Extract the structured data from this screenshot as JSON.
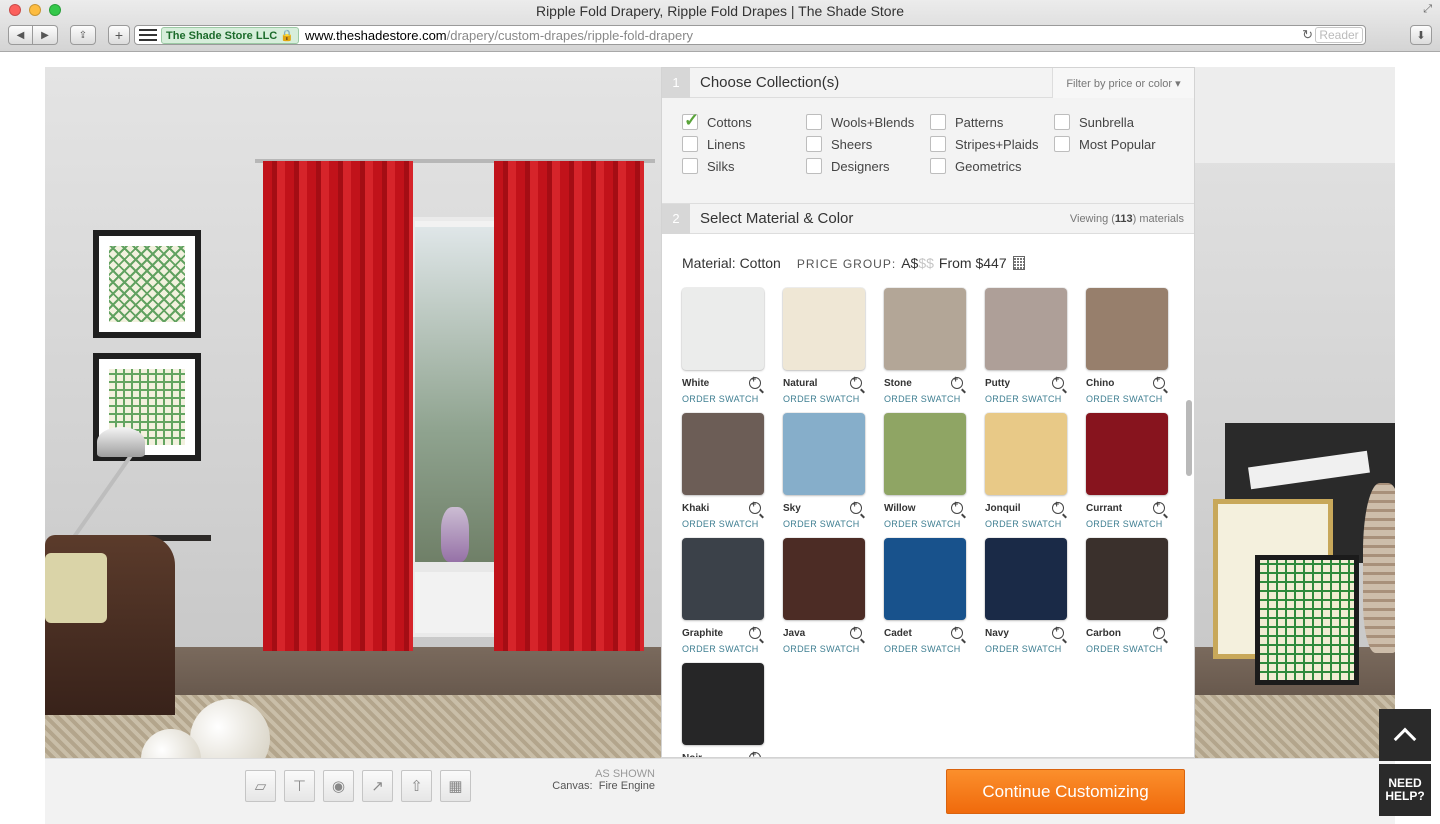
{
  "browser": {
    "window_title": "Ripple Fold Drapery, Ripple Fold Drapes | The Shade Store",
    "site_badge": "The Shade Store LLC",
    "url_host": "www.theshadestore.com",
    "url_path": "/drapery/custom-drapes/ripple-fold-drapery",
    "reader_label": "Reader"
  },
  "collections": {
    "step": "1",
    "title": "Choose Collection(s)",
    "filter_label": "Filter by price or color ▾",
    "items": [
      {
        "label": "Cottons",
        "checked": true
      },
      {
        "label": "Wools+Blends",
        "checked": false
      },
      {
        "label": "Patterns",
        "checked": false
      },
      {
        "label": "Sunbrella",
        "checked": false
      },
      {
        "label": "Linens",
        "checked": false
      },
      {
        "label": "Sheers",
        "checked": false
      },
      {
        "label": "Stripes+Plaids",
        "checked": false
      },
      {
        "label": "Most Popular",
        "checked": false
      },
      {
        "label": "Silks",
        "checked": false
      },
      {
        "label": "Designers",
        "checked": false
      },
      {
        "label": "Geometrics",
        "checked": false
      }
    ]
  },
  "materials": {
    "step": "2",
    "title": "Select Material & Color",
    "viewing_prefix": "Viewing (",
    "viewing_count": "113",
    "viewing_suffix": ") materials",
    "material_label": "Material: Cotton",
    "price_group_label": "PRICE GROUP:",
    "price_letter": "A",
    "price_dollars": "$",
    "price_dollars_dim": "$$",
    "price_from": "From $447",
    "order_swatch_label": "ORDER SWATCH",
    "swatches": [
      {
        "name": "White",
        "color": "#ebeceb"
      },
      {
        "name": "Natural",
        "color": "#efe7d5"
      },
      {
        "name": "Stone",
        "color": "#b3a697"
      },
      {
        "name": "Putty",
        "color": "#ae9f98"
      },
      {
        "name": "Chino",
        "color": "#977f6c"
      },
      {
        "name": "Khaki",
        "color": "#6c5d56"
      },
      {
        "name": "Sky",
        "color": "#86aeca"
      },
      {
        "name": "Willow",
        "color": "#8fa564"
      },
      {
        "name": "Jonquil",
        "color": "#e8c987"
      },
      {
        "name": "Currant",
        "color": "#87141e"
      },
      {
        "name": "Graphite",
        "color": "#3b4149"
      },
      {
        "name": "Java",
        "color": "#4c2c25"
      },
      {
        "name": "Cadet",
        "color": "#18528c"
      },
      {
        "name": "Navy",
        "color": "#1a2a47"
      },
      {
        "name": "Carbon",
        "color": "#3a302c"
      },
      {
        "name": "Noir",
        "color": "#262627"
      }
    ]
  },
  "toolbar": {
    "as_shown": "AS SHOWN",
    "canvas_label": "Canvas:",
    "canvas_value": "Fire Engine",
    "continue_label": "Continue Customizing",
    "need_help": "NEED HELP?"
  },
  "colors": {
    "accent_orange": "#f27a1a",
    "link_teal": "#3f7f92",
    "check_green": "#5aa43a",
    "curtain_red": "#c1121a"
  }
}
